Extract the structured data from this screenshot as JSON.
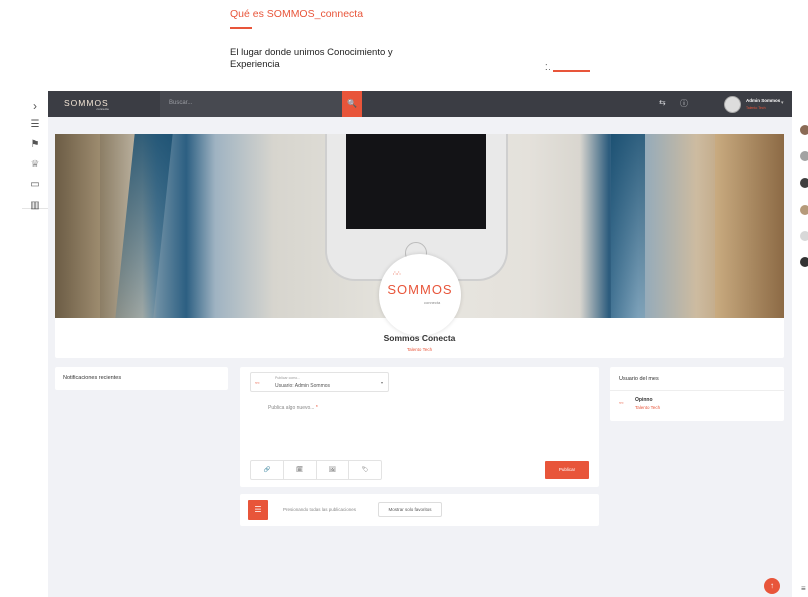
{
  "hero": {
    "link": "Qué es SOMMOS_connecta",
    "tagline": "El lugar donde unimos Conocimiento y Experiencia",
    "loader": "⁚."
  },
  "rail": {
    "icons": [
      "chevron-right-icon",
      "document-icon",
      "flag-icon",
      "trophy-icon",
      "monitor-icon",
      "panel-icon"
    ]
  },
  "topbar": {
    "logo": "SOMMOS",
    "logo_sub": "connecta",
    "search_placeholder": "Buscar...",
    "search_icon": "🔍",
    "icon_glyph_1": "⇆",
    "icon_glyph_2": "ⓘ",
    "user_name": "Admin Sommos",
    "user_role": "Talento Tech"
  },
  "profile": {
    "brand": "SOMMOS",
    "brand_sub": "connecta",
    "name": "Sommos Conecta",
    "role": "Talento Tech"
  },
  "notifications": {
    "title": "Notificaciones recientes"
  },
  "composer": {
    "select_label": "Publicar como...",
    "select_value": "Usuario: Admin Sommos",
    "mini_logo": "≈≈",
    "post_placeholder": "Publica algo nuevo...",
    "required_mark": "*",
    "actions": [
      "🔗",
      "🗓",
      "🖼",
      "🏷"
    ],
    "publish_label": "Publicar"
  },
  "filter": {
    "icon": "☰",
    "text": "Presionando todas las publicaciones",
    "favorites_label": "Mostrar solo favoritos"
  },
  "user_of_month": {
    "title": "Usuario del mes",
    "mini_logo": "≈≈",
    "name": "Opinno",
    "role": "Talento Tech"
  },
  "scroll_top": "↑",
  "menu_icon": "≡",
  "colors": {
    "accent": "#e8553a",
    "topbar": "#3b3d44",
    "background": "#f1f2f6"
  }
}
